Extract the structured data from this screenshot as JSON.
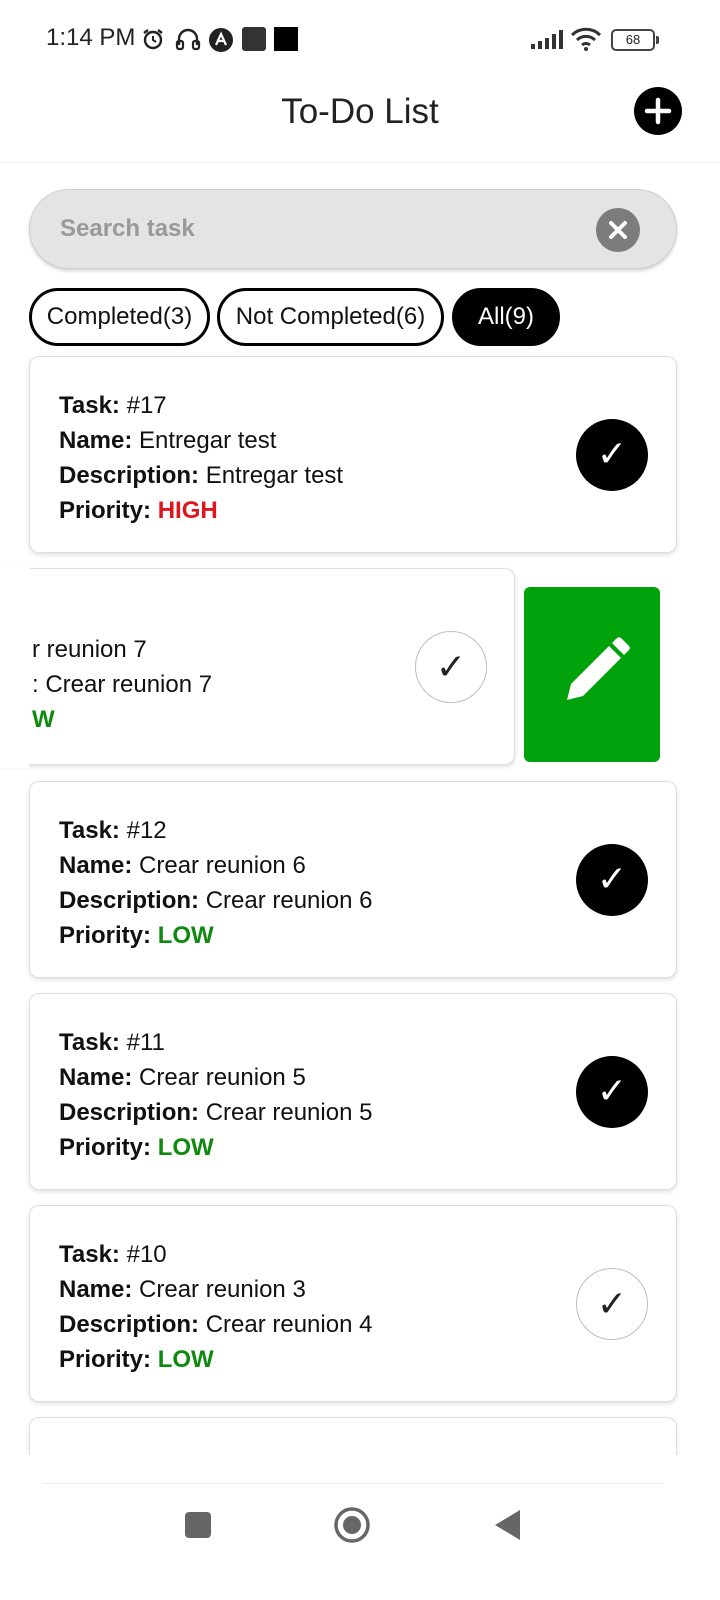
{
  "status_bar": {
    "time": "1:14 PM",
    "icons": [
      "alarm-icon",
      "headphones-icon",
      "app-notification-icon",
      "square-notification-icon",
      "square-notification-icon",
      "signal-icon",
      "wifi-icon",
      "battery-icon"
    ],
    "battery": "68"
  },
  "header": {
    "title": "To-Do List",
    "add_icon": "plus-icon"
  },
  "search": {
    "placeholder": "Search task",
    "value": "",
    "clear_icon": "close-icon"
  },
  "filters": [
    {
      "label": "Completed(3)",
      "active": false
    },
    {
      "label": "Not Completed(6)",
      "active": false
    },
    {
      "label": "All(9)",
      "active": true
    }
  ],
  "labels": {
    "task": "Task:",
    "name": "Name:",
    "description": "Description:",
    "priority": "Priority:"
  },
  "tasks": [
    {
      "task": "#17",
      "name": "Entregar test",
      "description": "Entregar test",
      "priority": "HIGH",
      "completed": true
    },
    {
      "name_partial": "r reunion 7",
      "description_partial": ": Crear reunion 7",
      "priority_partial": "W",
      "completed": false,
      "swiped": true
    },
    {
      "task": "#12",
      "name": "Crear reunion 6",
      "description": "Crear reunion 6",
      "priority": "LOW",
      "completed": true
    },
    {
      "task": "#11",
      "name": "Crear reunion 5",
      "description": "Crear reunion 5",
      "priority": "LOW",
      "completed": true
    },
    {
      "task": "#10",
      "name": "Crear reunion 3",
      "description": "Crear reunion 4",
      "priority": "LOW",
      "completed": false
    }
  ],
  "check_glyph": "✓",
  "edit_icon": "pencil-icon",
  "colors": {
    "priority_high": "#e0141b",
    "priority_low": "#0f8a0f",
    "edit_action": "#00a20b",
    "chip_active": "#000000"
  },
  "nav": [
    "recent-apps-icon",
    "home-icon",
    "back-icon"
  ]
}
